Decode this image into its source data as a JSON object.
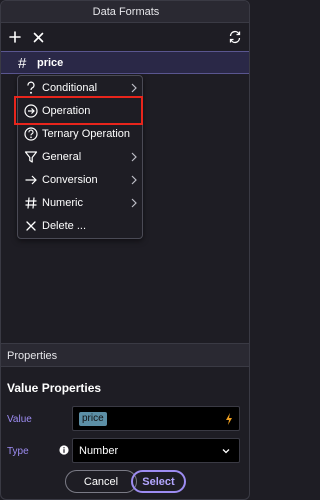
{
  "window": {
    "title": "Data Formats"
  },
  "toolbar": {
    "add_icon": "plus-icon",
    "close_icon": "close-icon",
    "refresh_icon": "refresh-icon"
  },
  "field": {
    "icon": "#",
    "name": "price"
  },
  "menu": {
    "items": [
      {
        "label": "Conditional",
        "icon": "question-icon",
        "submenu": true
      },
      {
        "label": "Operation",
        "icon": "arrow-circle-icon",
        "submenu": false,
        "highlighted": true
      },
      {
        "label": "Ternary Operation",
        "icon": "question-circle-icon",
        "submenu": false
      },
      {
        "label": "General",
        "icon": "funnel-icon",
        "submenu": true
      },
      {
        "label": "Conversion",
        "icon": "arrow-right-icon",
        "submenu": true
      },
      {
        "label": "Numeric",
        "icon": "hash-icon",
        "submenu": true
      },
      {
        "label": "Delete ...",
        "icon": "close-icon",
        "submenu": false
      }
    ]
  },
  "properties": {
    "header": "Properties",
    "section_title": "Value Properties",
    "value_label": "Value",
    "value_token": "price",
    "type_label": "Type",
    "type_value": "Number"
  },
  "buttons": {
    "cancel": "Cancel",
    "select": "Select"
  },
  "colors": {
    "background": "#1e1d24",
    "accent": "#9d8cf2",
    "highlight_border": "#e8251c",
    "token": "#5c8fa6",
    "bolt": "#f0a020"
  }
}
